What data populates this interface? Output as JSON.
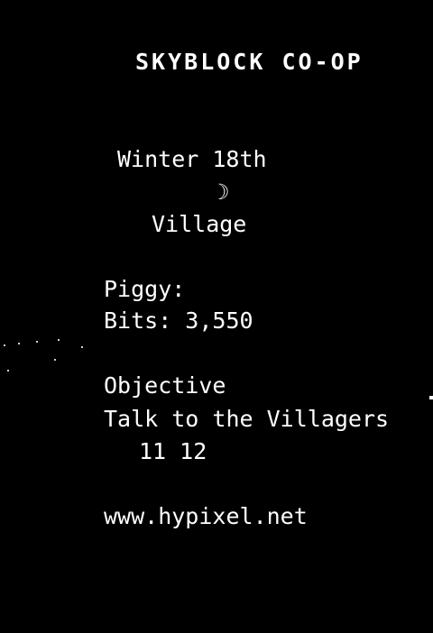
{
  "scoreboard": {
    "title": "SKYBLOCK CO-OP",
    "date": "Winter 18th",
    "time_icon": "☽",
    "location": "Village",
    "piggy_label": "Piggy:",
    "bits": "Bits: 3,550",
    "objective_label": "Objective",
    "objective_text": "Talk to the Villagers",
    "objective_progress": "11 12",
    "server_url": "www.hypixel.net"
  },
  "colors": {
    "background": "#000000",
    "text": "#ffffff"
  }
}
